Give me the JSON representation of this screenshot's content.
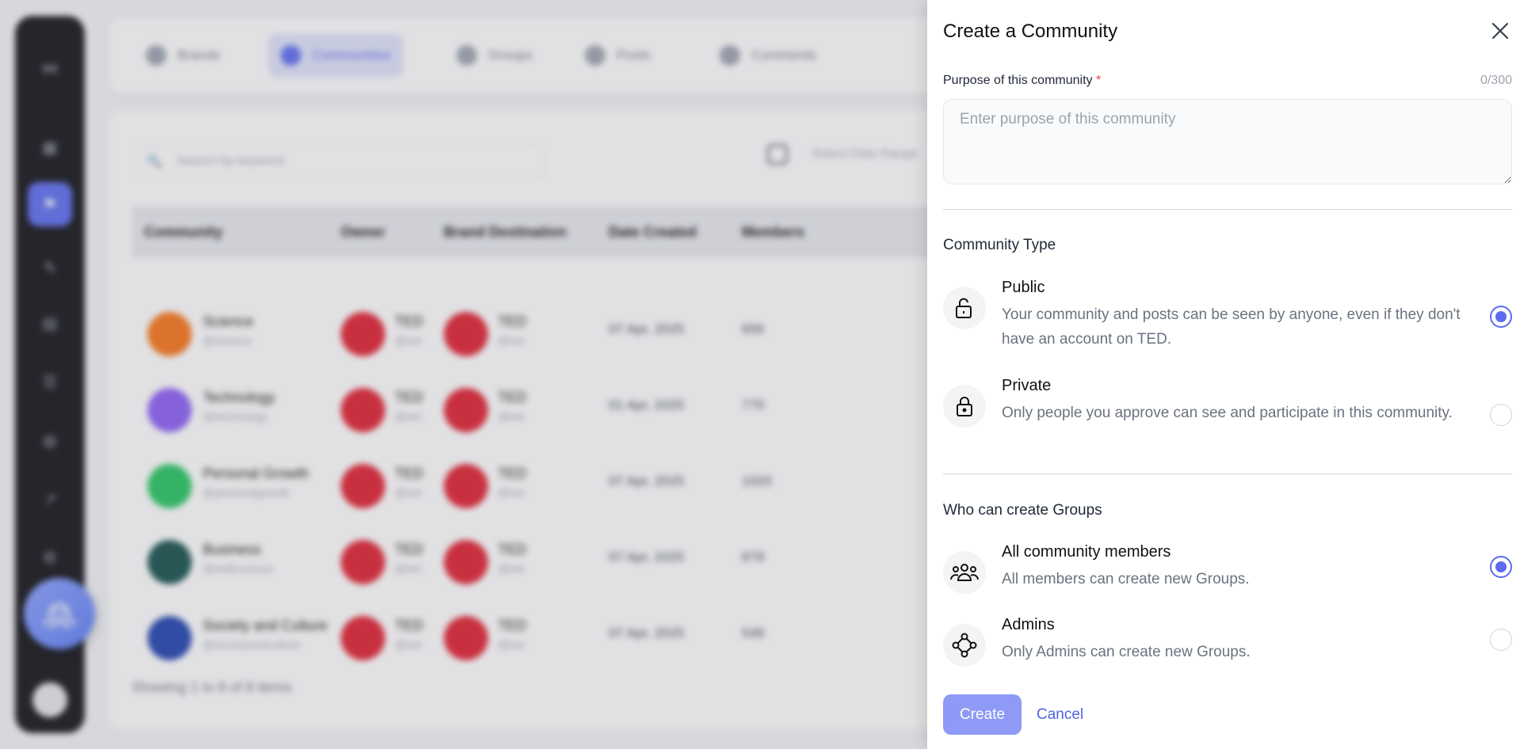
{
  "background": {
    "tabs": [
      "Brands",
      "Communities",
      "Groups",
      "Posts",
      "Comments"
    ],
    "search_placeholder": "Search by keyword",
    "date_placeholder": "Select Date Range",
    "columns": [
      "Community",
      "Owner",
      "Brand Destination",
      "Date Created",
      "Members"
    ],
    "rows": [
      {
        "name": "Science",
        "handle": "@science",
        "owner": "TED",
        "owner_handle": "@ted",
        "brand": "TED",
        "brand_handle": "@ted",
        "date": "07 Apr, 2025",
        "members": "656",
        "color": "#f97316"
      },
      {
        "name": "Technology",
        "handle": "@technology",
        "owner": "TED",
        "owner_handle": "@ted",
        "brand": "TED",
        "brand_handle": "@ted",
        "date": "01 Apr, 2025",
        "members": "770",
        "color": "#8b5cf6"
      },
      {
        "name": "Personal Growth",
        "handle": "@personalgrowth",
        "owner": "TED",
        "owner_handle": "@ted",
        "brand": "TED",
        "brand_handle": "@ted",
        "date": "07 Apr, 2025",
        "members": "1020",
        "color": "#22c55e"
      },
      {
        "name": "Business",
        "handle": "@tedbusiness",
        "owner": "TED",
        "owner_handle": "@ted",
        "brand": "TED",
        "brand_handle": "@ted",
        "date": "07 Apr, 2025",
        "members": "879",
        "color": "#134e4a"
      },
      {
        "name": "Society and Culture",
        "handle": "@societyandculture",
        "owner": "TED",
        "owner_handle": "@ted",
        "brand": "TED",
        "brand_handle": "@ted",
        "date": "07 Apr, 2025",
        "members": "549",
        "color": "#1e40af"
      }
    ],
    "footer": "Showing 1 to 8 of 8 items"
  },
  "drawer": {
    "title": "Create a Community",
    "purpose_label": "Purpose of this community",
    "required_mark": "*",
    "purpose_counter": "0/300",
    "purpose_placeholder": "Enter purpose of this community",
    "type_section": "Community Type",
    "type_options": [
      {
        "title": "Public",
        "desc": "Your community and posts can be seen by anyone, even if they don't have an account on TED.",
        "icon": "unlock-icon",
        "selected": true
      },
      {
        "title": "Private",
        "desc": "Only people you approve can see and participate in this community.",
        "icon": "lock-icon",
        "selected": false
      }
    ],
    "groups_section": "Who can create Groups",
    "group_options": [
      {
        "title": "All community members",
        "desc": "All members can create new Groups.",
        "icon": "people-icon",
        "selected": true
      },
      {
        "title": "Admins",
        "desc": "Only Admins can create new Groups.",
        "icon": "admin-nodes-icon",
        "selected": false
      }
    ],
    "create_label": "Create",
    "cancel_label": "Cancel"
  },
  "colors": {
    "accent": "#5b6cf0",
    "create_button": "#8e9af5",
    "required": "#ef4444"
  }
}
